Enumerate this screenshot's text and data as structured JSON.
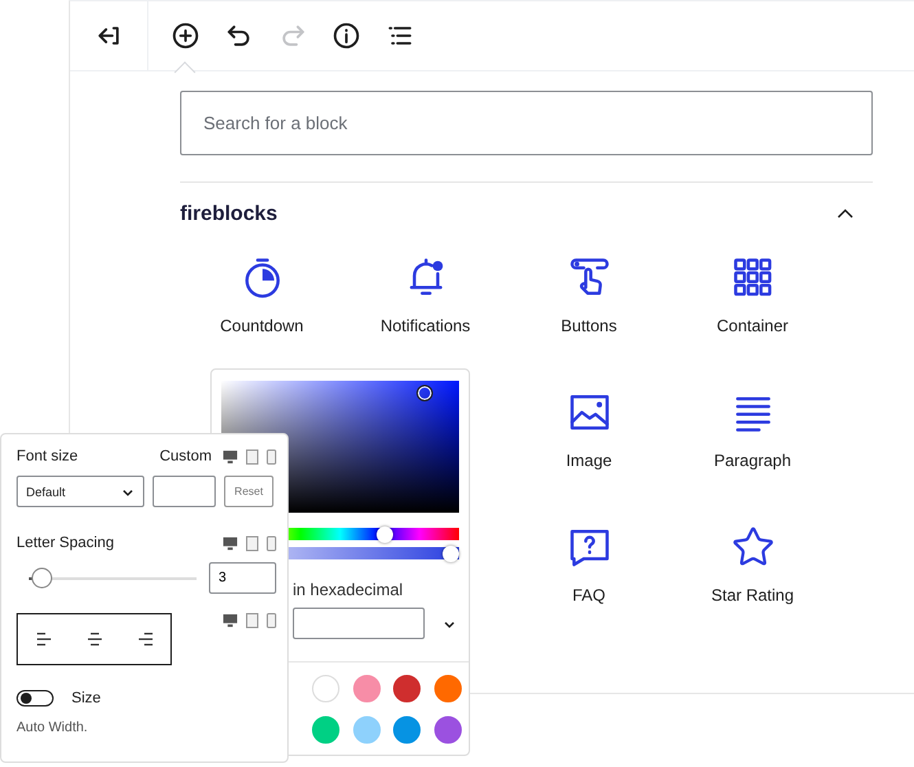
{
  "toolbar": [
    {
      "kind": "back",
      "disabled": false
    },
    {
      "kind": "add",
      "disabled": false
    },
    {
      "kind": "undo",
      "disabled": false
    },
    {
      "kind": "redo",
      "disabled": true
    },
    {
      "kind": "info",
      "disabled": false
    },
    {
      "kind": "outline",
      "disabled": false
    }
  ],
  "inserter": {
    "open": true
  },
  "search": {
    "placeholder": "Search for a block"
  },
  "category": {
    "title": "fireblocks",
    "expanded": true
  },
  "blocks": [
    {
      "kind": "countdown",
      "label": "Countdown"
    },
    {
      "kind": "notifications",
      "label": "Notifications"
    },
    {
      "kind": "buttons",
      "label": "Buttons"
    },
    {
      "kind": "container",
      "label": "Container"
    },
    {
      "kind": "image",
      "label": "Image"
    },
    {
      "kind": "paragraph",
      "label": "Paragraph"
    },
    {
      "kind": "faq",
      "label": "FAQ"
    },
    {
      "kind": "star",
      "label": "Star Rating"
    }
  ],
  "color_picker": {
    "hue": {
      "level": 0.7
    },
    "alpha": {
      "level": 1
    },
    "hex_label": "in hexadecimal",
    "swatches": [
      {
        "color": "#ffffff"
      },
      {
        "color": "#f78da7"
      },
      {
        "color": "#cf2e2e"
      },
      {
        "color": "#ff6900"
      },
      {
        "color": "#00d084"
      },
      {
        "color": "#8ed1fc"
      },
      {
        "color": "#0693e3"
      },
      {
        "color": "#9b51e0"
      }
    ]
  },
  "settings": {
    "font_size_label": "Font size",
    "custom_label": "Custom",
    "font_size_value": "Default",
    "reset": "Reset",
    "letter_spacing_label": "Letter Spacing",
    "letter_spacing": {
      "level": 0.08,
      "value": "3"
    },
    "toggle": {
      "on": false,
      "label": "Size"
    },
    "hint": "Auto Width."
  }
}
